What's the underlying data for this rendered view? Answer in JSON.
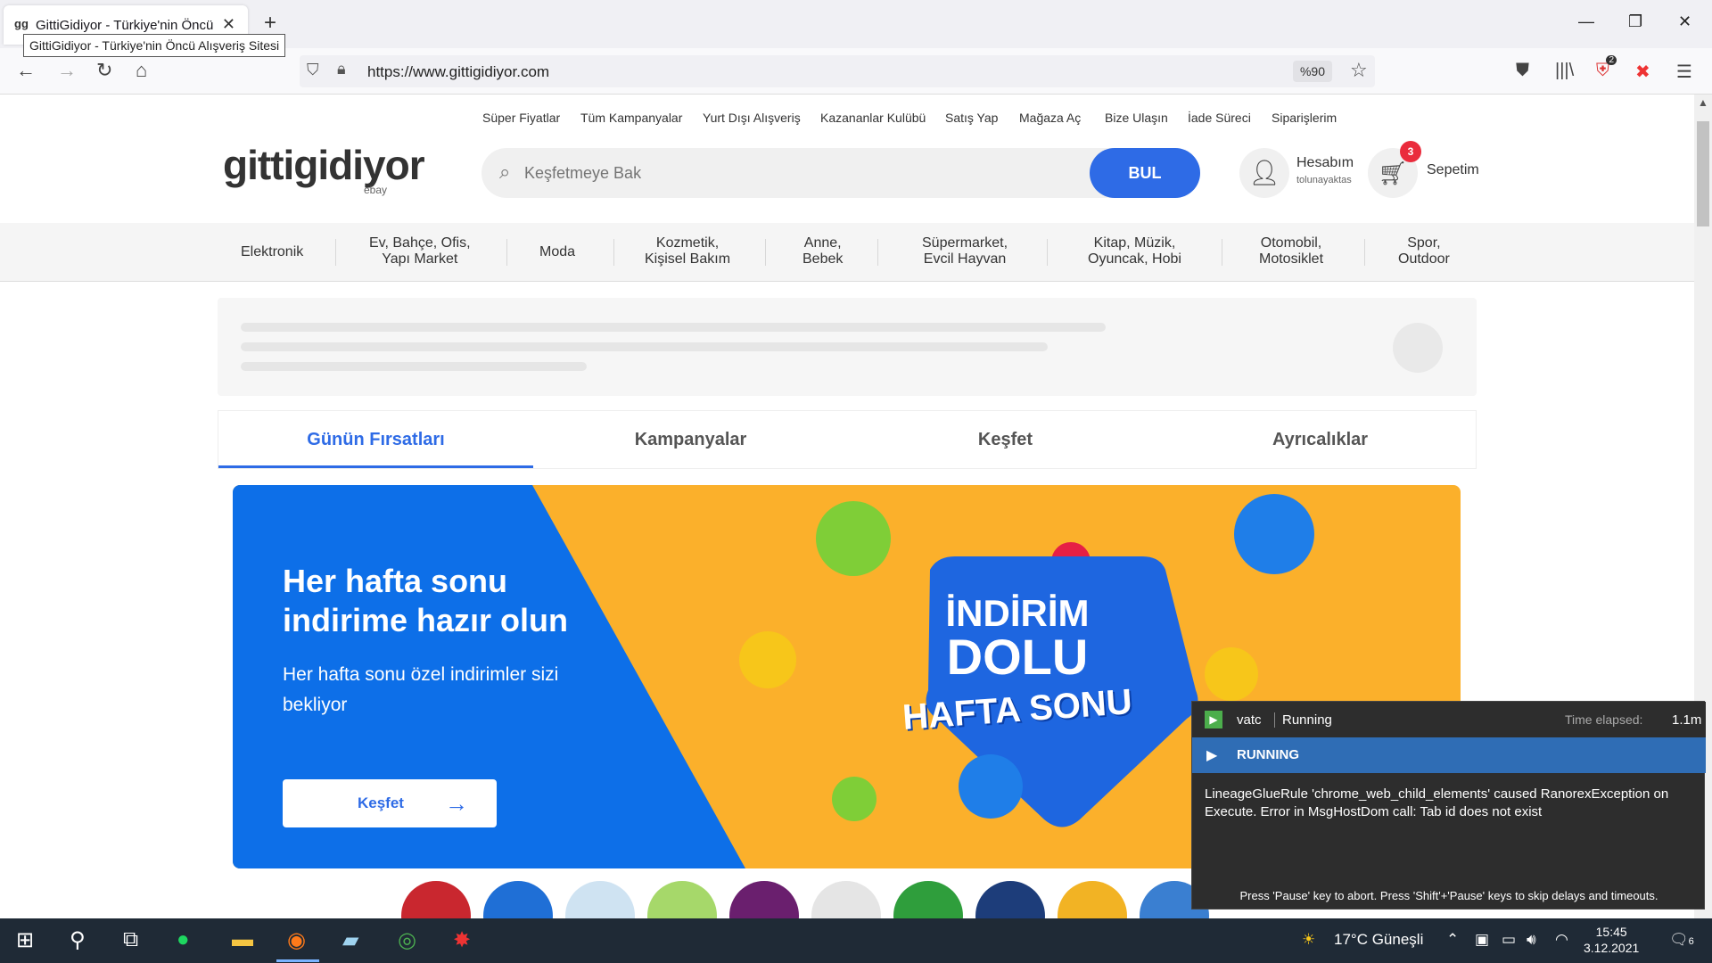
{
  "browser": {
    "tab_title": "GittiGidiyor - Türkiye'nin Öncü Alışveriş Sitesi",
    "tab_favicon": "gg",
    "tooltip": "GittiGidiyor - Türkiye'nin Öncü Alışveriş Sitesi",
    "url": "https://www.gittigidiyor.com",
    "zoom": "%90",
    "extension_badge": "2"
  },
  "site": {
    "top_links": [
      "Süper Fiyatlar",
      "Tüm Kampanyalar",
      "Yurt Dışı Alışveriş",
      "Kazananlar Kulübü",
      "Satış Yap",
      "Mağaza Aç",
      "Bize Ulaşın",
      "İade Süreci",
      "Siparişlerim"
    ],
    "logo": "gittigidiyor",
    "logo_sub": "ebay",
    "search_placeholder": "Keşfetmeye Bak",
    "search_button": "BUL",
    "account_label": "Hesabım",
    "account_user": "tolunayaktas",
    "cart_label": "Sepetim",
    "cart_count": "3",
    "categories": [
      {
        "line1": "Elektronik",
        "line2": ""
      },
      {
        "line1": "Ev, Bahçe, Ofis,",
        "line2": "Yapı Market"
      },
      {
        "line1": "Moda",
        "line2": ""
      },
      {
        "line1": "Kozmetik,",
        "line2": "Kişisel Bakım"
      },
      {
        "line1": "Anne,",
        "line2": "Bebek"
      },
      {
        "line1": "Süpermarket,",
        "line2": "Evcil Hayvan"
      },
      {
        "line1": "Kitap, Müzik,",
        "line2": "Oyuncak, Hobi"
      },
      {
        "line1": "Otomobil,",
        "line2": "Motosiklet"
      },
      {
        "line1": "Spor,",
        "line2": "Outdoor"
      }
    ],
    "content_tabs": [
      "Günün Fırsatları",
      "Kampanyalar",
      "Keşfet",
      "Ayrıcalıklar"
    ],
    "active_tab": "Günün Fırsatları",
    "banner": {
      "headline": "Her hafta sonu indirime hazır olun",
      "subtext": "Her hafta sonu özel indirimler sizi bekliyor",
      "cta": "Keşfet",
      "badge_line1": "İNDİRİM",
      "badge_line2": "DOLU",
      "badge_line3": "HAFTA SONU"
    },
    "story_circle_colors": [
      "#c9272f",
      "#1f6fd6",
      "#cfe3f2",
      "#a6d86a",
      "#6a1f6e",
      "#e5e5e5",
      "#2f9e3c",
      "#1d3d7a",
      "#f2b324",
      "#3a7fd1"
    ]
  },
  "ranorex": {
    "name": "vatc",
    "status": "Running",
    "elapsed_label": "Time elapsed:",
    "elapsed_value": "1.1m",
    "running_label": "RUNNING",
    "message": "LineageGlueRule 'chrome_web_child_elements' caused RanorexException on Execute. Error in MsgHostDom call: Tab id does not exist",
    "footer": "Press 'Pause' key to abort. Press 'Shift'+'Pause' keys to skip delays and timeouts."
  },
  "taskbar": {
    "weather": "17°C  Güneşli",
    "time": "15:45",
    "date": "3.12.2021",
    "notifications": "6"
  },
  "colors": {
    "accent": "#2e6be6",
    "banner_blue": "#0d6fe8",
    "banner_yellow": "#fbb02b",
    "cart_badge": "#ea2b3c",
    "ranorex_running": "#2f6db5"
  }
}
